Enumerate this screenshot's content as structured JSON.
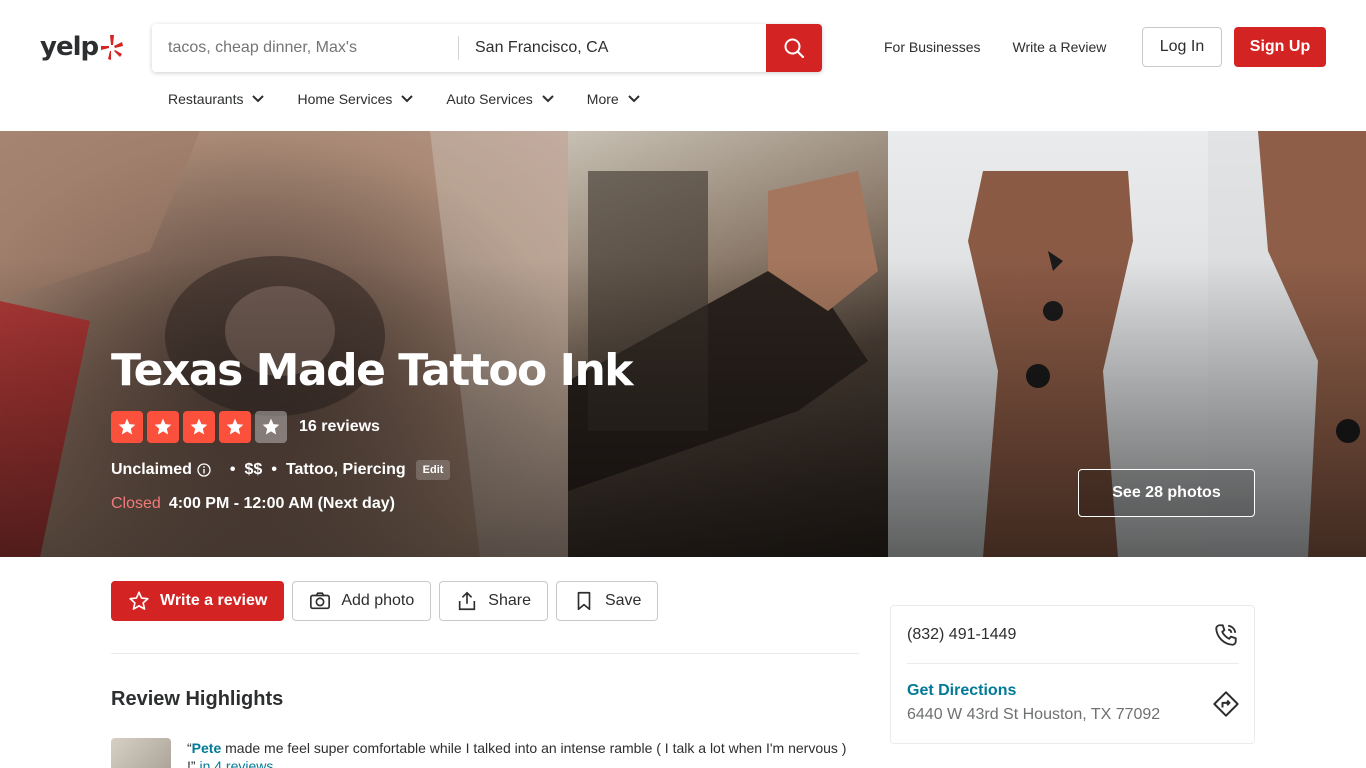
{
  "header": {
    "logo_text": "yelp",
    "search": {
      "find_placeholder": "tacos, cheap dinner, Max's",
      "near_value": "San Francisco, CA"
    },
    "links": [
      "For Businesses",
      "Write a Review"
    ],
    "login_label": "Log In",
    "signup_label": "Sign Up",
    "categories": [
      "Restaurants",
      "Home Services",
      "Auto Services",
      "More"
    ]
  },
  "business": {
    "name": "Texas Made Tattoo Ink",
    "rating": 4,
    "rating_max": 5,
    "review_count": "16 reviews",
    "claim_status": "Unclaimed",
    "price": "$$",
    "categories": "Tattoo, Piercing",
    "edit_label": "Edit",
    "open_status": "Closed",
    "hours": "4:00 PM - 12:00 AM (Next day)",
    "see_photos_label": "See 28 photos"
  },
  "actions": {
    "write_review": "Write a review",
    "add_photo": "Add photo",
    "share": "Share",
    "save": "Save"
  },
  "highlights": {
    "title": "Review Highlights",
    "item": {
      "open_quote": "“",
      "name": "Pete",
      "text": " made me feel super comfortable while I talked into an intense ramble ( I talk a lot when I'm nervous ) !”",
      "link": " in 4 reviews"
    }
  },
  "sidebar": {
    "phone": "(832) 491-1449",
    "directions_label": "Get Directions",
    "address": "6440 W 43rd St Houston, TX 77092"
  },
  "colors": {
    "brand_red": "#d32323",
    "star_red": "#fb503b",
    "link_teal": "#027a97",
    "closed_red": "#f17a7a"
  },
  "icons": {
    "search": "search-icon",
    "chevron": "chevron-down-icon",
    "star": "star-icon",
    "camera": "camera-icon",
    "share": "share-icon",
    "bookmark": "bookmark-icon",
    "phone": "phone-icon",
    "directions": "directions-icon",
    "info": "info-icon"
  }
}
